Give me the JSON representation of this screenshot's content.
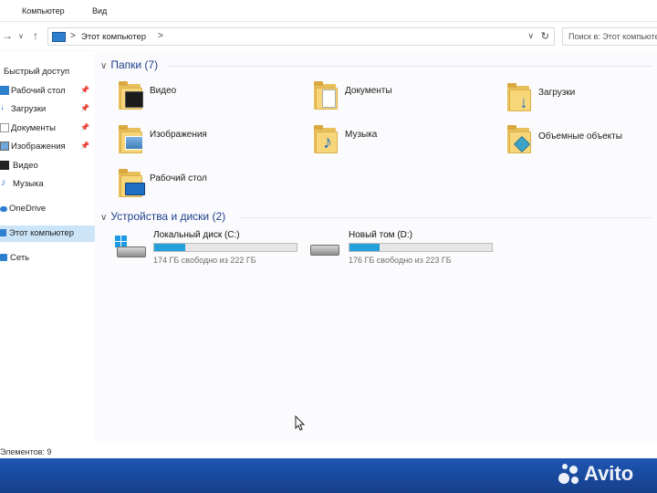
{
  "menubar": {
    "items": [
      "Компьютер",
      "Вид"
    ]
  },
  "address": {
    "crumb": "Этот компьютер",
    "separator": ">",
    "search_placeholder": "Поиск в: Этот компьютер"
  },
  "sidebar": {
    "quick_access": "Быстрый доступ",
    "items": [
      {
        "label": "Рабочий стол",
        "icon": "desktop-icon",
        "pinned": true
      },
      {
        "label": "Загрузки",
        "icon": "downloads-icon",
        "pinned": true
      },
      {
        "label": "Документы",
        "icon": "documents-icon",
        "pinned": true
      },
      {
        "label": "Изображения",
        "icon": "pictures-icon",
        "pinned": true
      },
      {
        "label": "Видео",
        "icon": "video-icon",
        "pinned": false
      },
      {
        "label": "Музыка",
        "icon": "music-icon",
        "pinned": false
      }
    ],
    "onedrive": "OneDrive",
    "this_pc": "Этот компьютер",
    "network": "Сеть"
  },
  "folders_group": {
    "title": "Папки (7)",
    "items": [
      {
        "name": "Видео",
        "icon": "video-folder-icon"
      },
      {
        "name": "Документы",
        "icon": "documents-folder-icon"
      },
      {
        "name": "Загрузки",
        "icon": "downloads-folder-icon"
      },
      {
        "name": "Изображения",
        "icon": "pictures-folder-icon"
      },
      {
        "name": "Музыка",
        "icon": "music-folder-icon"
      },
      {
        "name": "Объемные объекты",
        "icon": "3d-objects-folder-icon"
      },
      {
        "name": "Рабочий стол",
        "icon": "desktop-folder-icon"
      }
    ]
  },
  "drives_group": {
    "title": "Устройства и диски (2)",
    "items": [
      {
        "name": "Локальный диск (C:)",
        "free_text": "174 ГБ свободно из 222 ГБ",
        "used_fraction": 0.22,
        "icon": "windows-drive-icon"
      },
      {
        "name": "Новый том (D:)",
        "free_text": "176 ГБ свободно из 223 ГБ",
        "used_fraction": 0.21,
        "icon": "hard-drive-icon"
      }
    ]
  },
  "status": {
    "items_count": "Элементов: 9"
  },
  "watermark": {
    "text": "Avito"
  },
  "colors": {
    "accent": "#26a0da",
    "selection": "#cce4f7",
    "header_blue": "#1e3f8a",
    "folder_yellow": "#f7d67a",
    "taskbar": "#1d56b3"
  }
}
